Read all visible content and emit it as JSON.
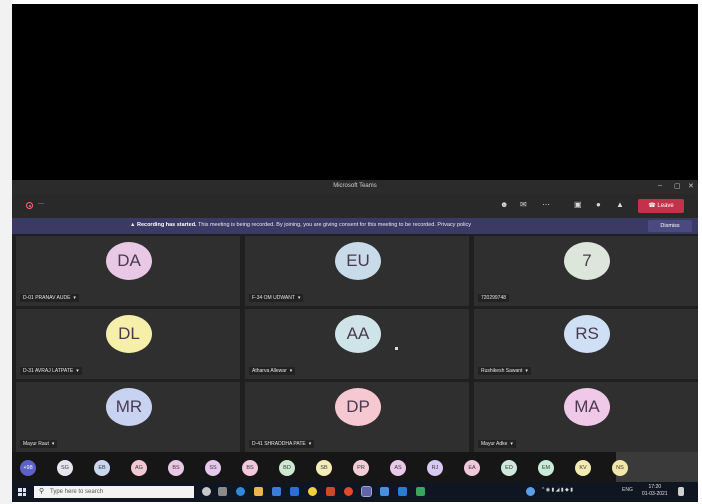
{
  "window": {
    "title": "Microsoft Teams",
    "minimize": "–",
    "restore": "▢",
    "close": "✕"
  },
  "toolbar": {
    "timer": "---",
    "icons": [
      "participants-icon",
      "chat-icon",
      "more-icon",
      "camera-icon",
      "mic-icon",
      "share-icon"
    ],
    "leave_label": "Leave",
    "leave_color": "#c4314b"
  },
  "banner": {
    "bold": "Recording has started.",
    "text": " This meeting is being recorded. By joining, you are giving consent for this meeting to be recorded. Privacy policy",
    "dismiss": "Dismiss",
    "color": "#3b3a64"
  },
  "participants": [
    {
      "initials": "DA",
      "name": "D-01 PRANAV AUDE",
      "color": "#e9c8e6"
    },
    {
      "initials": "EU",
      "name": "F-34 OM UDWANT",
      "color": "#c9dbe8"
    },
    {
      "initials": "7",
      "name": "720299748",
      "color": "#dde6da"
    },
    {
      "initials": "DL",
      "name": "D-31 AVRAJ LATPATE",
      "color": "#f6efaa"
    },
    {
      "initials": "AA",
      "name": "Atharva Allewar",
      "color": "#cfe4e8"
    },
    {
      "initials": "RS",
      "name": "Rushikesh Sawant",
      "color": "#cfe0f6"
    },
    {
      "initials": "MR",
      "name": "Mayur Raut",
      "color": "#c8d3f2"
    },
    {
      "initials": "DP",
      "name": "D-41 SHRADDHA PATE",
      "color": "#f6c8d2"
    },
    {
      "initials": "MA",
      "name": "Mayur Adke",
      "color": "#f0c8e8"
    }
  ],
  "tray": [
    {
      "label": "+98",
      "color": "#5b63c9"
    },
    {
      "label": "SG",
      "color": "#e6e6ee"
    },
    {
      "label": "EB",
      "color": "#c8d6ee"
    },
    {
      "label": "AG",
      "color": "#f2c8d4"
    },
    {
      "label": "BS",
      "color": "#eac8e4"
    },
    {
      "label": "SS",
      "color": "#e6c8ee"
    },
    {
      "label": "BS",
      "color": "#f2c8dc"
    },
    {
      "label": "BD",
      "color": "#cfe8d2"
    },
    {
      "label": "SB",
      "color": "#f2ecb8"
    },
    {
      "label": "PR",
      "color": "#f2ccd6"
    },
    {
      "label": "AS",
      "color": "#eac8e8"
    },
    {
      "label": "RJ",
      "color": "#d8c8f2"
    },
    {
      "label": "EA",
      "color": "#f0c8dc"
    },
    {
      "label": "ED",
      "color": "#cfe8dc"
    },
    {
      "label": "EM",
      "color": "#c8ecd8"
    },
    {
      "label": "KV",
      "color": "#f2eab0"
    },
    {
      "label": "NS",
      "color": "#f2e6a8"
    }
  ],
  "taskbar": {
    "search_placeholder": "Type here to search",
    "tray_text": "ENG",
    "time": "17:20",
    "date": "01-03-2021"
  }
}
